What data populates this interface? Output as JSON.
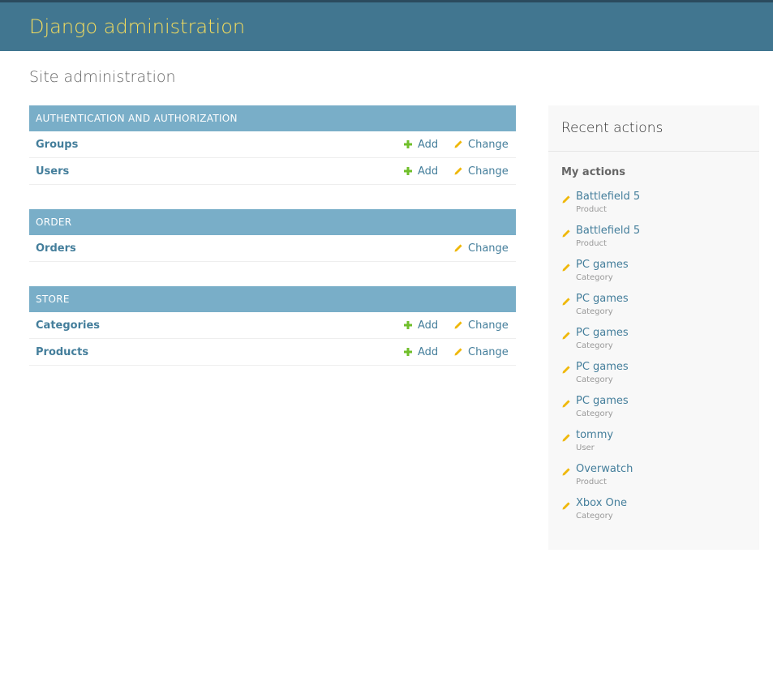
{
  "header": {
    "title": "Django administration"
  },
  "page": {
    "title": "Site administration"
  },
  "modules": [
    {
      "caption": "AUTHENTICATION AND AUTHORIZATION",
      "models": [
        {
          "name": "Groups",
          "add": "Add",
          "change": "Change"
        },
        {
          "name": "Users",
          "add": "Add",
          "change": "Change"
        }
      ]
    },
    {
      "caption": "ORDER",
      "models": [
        {
          "name": "Orders",
          "change": "Change"
        }
      ]
    },
    {
      "caption": "STORE",
      "models": [
        {
          "name": "Categories",
          "add": "Add",
          "change": "Change"
        },
        {
          "name": "Products",
          "add": "Add",
          "change": "Change"
        }
      ]
    }
  ],
  "recent": {
    "title": "Recent actions",
    "subtitle": "My actions",
    "items": [
      {
        "name": "Battlefield 5",
        "type": "Product"
      },
      {
        "name": "Battlefield 5",
        "type": "Product"
      },
      {
        "name": "PC games",
        "type": "Category"
      },
      {
        "name": "PC games",
        "type": "Category"
      },
      {
        "name": "PC games",
        "type": "Category"
      },
      {
        "name": "PC games",
        "type": "Category"
      },
      {
        "name": "PC games",
        "type": "Category"
      },
      {
        "name": "tommy",
        "type": "User"
      },
      {
        "name": "Overwatch",
        "type": "Product"
      },
      {
        "name": "Xbox One",
        "type": "Category"
      }
    ]
  },
  "icons": {
    "add": "plus-icon",
    "change": "pencil-icon"
  },
  "colors": {
    "header_bg": "#417690",
    "header_text": "#f5dd5d",
    "caption_bg": "#79aec8",
    "link": "#447e9b",
    "add_icon": "#70bf2b",
    "change_icon": "#efb80b"
  }
}
